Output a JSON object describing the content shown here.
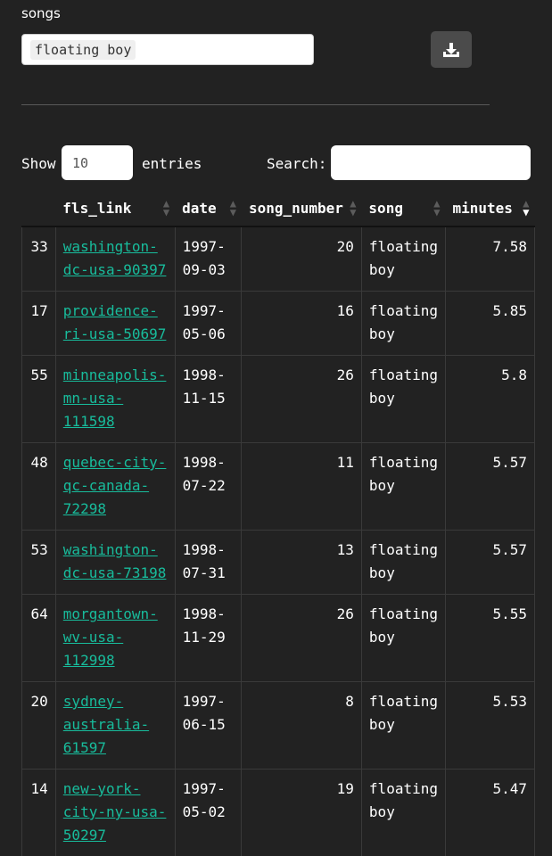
{
  "filter": {
    "label": "songs",
    "selected_chip": "floating boy",
    "download_icon": "download-icon"
  },
  "length_menu": {
    "show_label": "Show",
    "value": "10",
    "entries_label": "entries"
  },
  "search": {
    "label": "Search:",
    "value": ""
  },
  "table": {
    "columns": [
      "",
      "fls_link",
      "date",
      "song_number",
      "song",
      "minutes"
    ],
    "sorted_column": "minutes",
    "sort_direction": "descending",
    "rows": [
      {
        "id": "33",
        "fls_link": "washington-dc-usa-90397",
        "link_lines": [
          "washington-",
          "dc-usa-90397"
        ],
        "date_lines": [
          "1997-",
          "09-03"
        ],
        "song_number": "20",
        "song_lines": [
          "floating",
          "boy"
        ],
        "minutes": "7.58"
      },
      {
        "id": "17",
        "fls_link": "providence-ri-usa-50697",
        "link_lines": [
          "providence-",
          "ri-usa-50697"
        ],
        "date_lines": [
          "1997-",
          "05-06"
        ],
        "song_number": "16",
        "song_lines": [
          "floating",
          "boy"
        ],
        "minutes": "5.85"
      },
      {
        "id": "55",
        "fls_link": "minneapolis-mn-usa-111598",
        "link_lines": [
          "minneapolis-",
          "mn-usa-111598"
        ],
        "date_lines": [
          "1998-",
          "11-15"
        ],
        "song_number": "26",
        "song_lines": [
          "floating",
          "boy"
        ],
        "minutes": "5.8"
      },
      {
        "id": "48",
        "fls_link": "quebec-city-qc-canada-72298",
        "link_lines": [
          "quebec-city-",
          "qc-canada-",
          "72298"
        ],
        "date_lines": [
          "1998-",
          "07-22"
        ],
        "song_number": "11",
        "song_lines": [
          "floating",
          "boy"
        ],
        "minutes": "5.57"
      },
      {
        "id": "53",
        "fls_link": "washington-dc-usa-73198",
        "link_lines": [
          "washington-",
          "dc-usa-73198"
        ],
        "date_lines": [
          "1998-",
          "07-31"
        ],
        "song_number": "13",
        "song_lines": [
          "floating",
          "boy"
        ],
        "minutes": "5.57"
      },
      {
        "id": "64",
        "fls_link": "morgantown-wv-usa-112998",
        "link_lines": [
          "morgantown-",
          "wv-usa-112998"
        ],
        "date_lines": [
          "1998-",
          "11-29"
        ],
        "song_number": "26",
        "song_lines": [
          "floating",
          "boy"
        ],
        "minutes": "5.55"
      },
      {
        "id": "20",
        "fls_link": "sydney-australia-61597",
        "link_lines": [
          "sydney-",
          "australia-",
          "61597"
        ],
        "date_lines": [
          "1997-",
          "06-15"
        ],
        "song_number": "8",
        "song_lines": [
          "floating",
          "boy"
        ],
        "minutes": "5.53"
      },
      {
        "id": "14",
        "fls_link": "new-york-city-ny-usa-50297",
        "link_lines": [
          "new-york-",
          "city-ny-usa-",
          "50297"
        ],
        "date_lines": [
          "1997-",
          "05-02"
        ],
        "song_number": "19",
        "song_lines": [
          "floating",
          "boy"
        ],
        "minutes": "5.47"
      }
    ]
  },
  "colors": {
    "background": "#222222",
    "link": "#18bc9c",
    "button": "#4b4b4b"
  }
}
